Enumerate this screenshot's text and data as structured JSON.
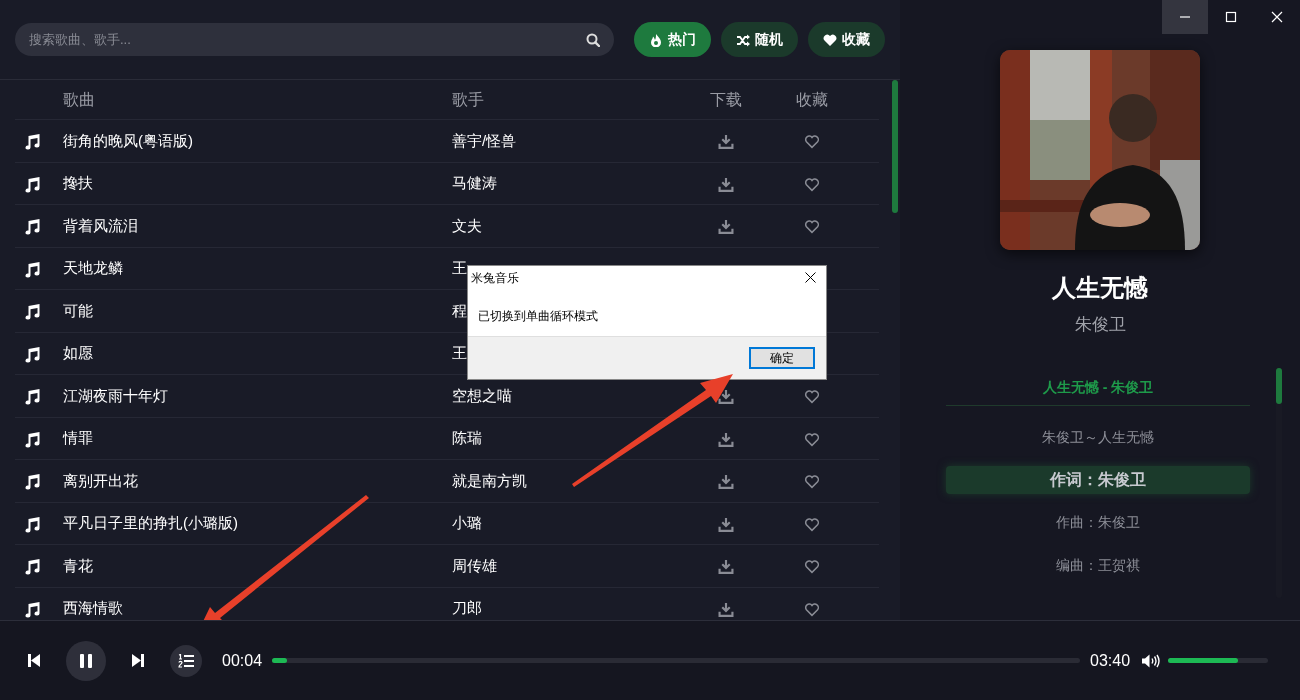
{
  "window_controls": [
    {
      "kind": "minimize",
      "hovered": true
    },
    {
      "kind": "maximize",
      "hovered": false
    },
    {
      "kind": "close",
      "hovered": false
    }
  ],
  "search": {
    "placeholder": "搜索歌曲、歌手..."
  },
  "filters": [
    {
      "label": "热门",
      "kind": "fire",
      "selected": true
    },
    {
      "label": "随机",
      "kind": "shuffle",
      "selected": false
    },
    {
      "label": "收藏",
      "kind": "heart",
      "selected": false
    }
  ],
  "table": {
    "columns": [
      "歌曲",
      "歌手",
      "下载",
      "收藏"
    ],
    "rows": [
      {
        "song": "街角的晚风(粤语版)",
        "singer": "善宇/怪兽"
      },
      {
        "song": "搀扶",
        "singer": "马健涛"
      },
      {
        "song": "背着风流泪",
        "singer": "文夫"
      },
      {
        "song": "天地龙鳞",
        "singer": "王"
      },
      {
        "song": "可能",
        "singer": "程"
      },
      {
        "song": "如愿",
        "singer": "王"
      },
      {
        "song": "江湖夜雨十年灯",
        "singer": "空想之喵"
      },
      {
        "song": "情罪",
        "singer": "陈瑞"
      },
      {
        "song": "离别开出花",
        "singer": "就是南方凯"
      },
      {
        "song": "平凡日子里的挣扎(小璐版)",
        "singer": "小璐"
      },
      {
        "song": "青花",
        "singer": "周传雄"
      },
      {
        "song": "西海情歌",
        "singer": "刀郎"
      }
    ]
  },
  "now_playing": {
    "title": "人生无憾",
    "artist": "朱俊卫"
  },
  "lyrics": [
    {
      "text": "人生无憾 - 朱俊卫",
      "kind": "heading",
      "selected": false
    },
    {
      "text": "朱俊卫～人生无憾",
      "kind": "line",
      "selected": false
    },
    {
      "text": "作词：朱俊卫",
      "kind": "line",
      "selected": true
    },
    {
      "text": "作曲：朱俊卫",
      "kind": "line",
      "selected": false
    },
    {
      "text": "编曲：王贺祺",
      "kind": "line",
      "selected": false
    }
  ],
  "dialog": {
    "title": "米兔音乐",
    "message": "已切换到单曲循环模式",
    "button": "确定"
  },
  "player": {
    "playing": true,
    "elapsed": "00:04",
    "progress": {
      "level": 0.018
    },
    "duration": "03:40",
    "volume": {
      "level": 0.7
    }
  }
}
